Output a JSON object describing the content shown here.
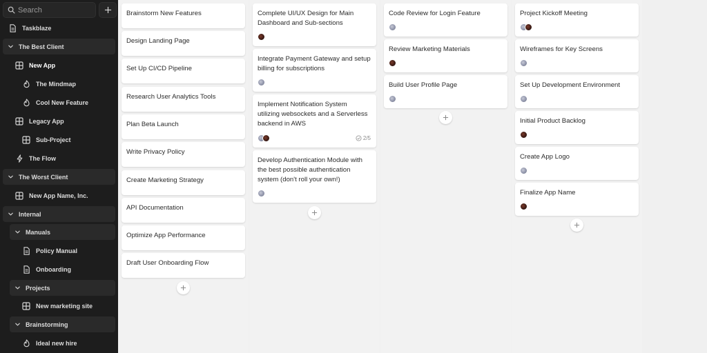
{
  "sidebar": {
    "search_placeholder": "Search",
    "items": [
      {
        "label": "Taskblaze",
        "icon": "doc-icon"
      },
      {
        "label": "The Best Client",
        "icon": "chevron-down-icon"
      },
      {
        "label": "New App",
        "icon": "board-icon"
      },
      {
        "label": "The Mindmap",
        "icon": "flame-icon"
      },
      {
        "label": "Cool New Feature",
        "icon": "flame-icon"
      },
      {
        "label": "Legacy App",
        "icon": "board-icon"
      },
      {
        "label": "Sub-Project",
        "icon": "board-icon"
      },
      {
        "label": "The Flow",
        "icon": "bolt-icon"
      },
      {
        "label": "The Worst Client",
        "icon": "chevron-down-icon"
      },
      {
        "label": "New App Name, Inc.",
        "icon": "board-icon"
      },
      {
        "label": "Internal",
        "icon": "chevron-down-icon"
      },
      {
        "label": "Manuals",
        "icon": "chevron-down-icon"
      },
      {
        "label": "Policy Manual",
        "icon": "doc-icon"
      },
      {
        "label": "Onboarding",
        "icon": "doc-icon"
      },
      {
        "label": "Projects",
        "icon": "chevron-down-icon"
      },
      {
        "label": "New marketing site",
        "icon": "board-icon"
      },
      {
        "label": "Brainstorming",
        "icon": "chevron-down-icon"
      },
      {
        "label": "Ideal new hire",
        "icon": "flame-icon"
      }
    ]
  },
  "columns": [
    {
      "cards": [
        {
          "title": "Brainstorm New Features"
        },
        {
          "title": "Design Landing Page"
        },
        {
          "title": "Set Up CI/CD Pipeline"
        },
        {
          "title": "Research User Analytics Tools"
        },
        {
          "title": "Plan Beta Launch"
        },
        {
          "title": "Write Privacy Policy"
        },
        {
          "title": "Create Marketing Strategy"
        },
        {
          "title": "API Documentation"
        },
        {
          "title": "Optimize App Performance"
        },
        {
          "title": "Draft User Onboarding Flow"
        }
      ]
    },
    {
      "cards": [
        {
          "title": "Complete UI/UX Design for Main Dashboard and Sub-sections",
          "avatars": [
            "a2"
          ]
        },
        {
          "title": "Integrate Payment Gateway and setup billing for subscriptions",
          "avatars": [
            "a1"
          ]
        },
        {
          "title": "Implement Notification System utilizing websockets and a Serverless backend in AWS",
          "avatars": [
            "a1",
            "a2"
          ],
          "progress": "2/5"
        },
        {
          "title": "Develop Authentication Module with the best possible authentication system (don't roll your own!)",
          "avatars": [
            "a1"
          ]
        }
      ]
    },
    {
      "cards": [
        {
          "title": "Code Review for Login Feature",
          "avatars": [
            "a1"
          ]
        },
        {
          "title": "Review Marketing Materials",
          "avatars": [
            "a2"
          ]
        },
        {
          "title": "Build User Profile Page",
          "avatars": [
            "a1"
          ]
        }
      ]
    },
    {
      "cards": [
        {
          "title": "Project Kickoff Meeting",
          "avatars": [
            "a1",
            "a2"
          ]
        },
        {
          "title": "Wireframes for Key Screens",
          "avatars": [
            "a1"
          ]
        },
        {
          "title": "Set Up Development Environment",
          "avatars": [
            "a1"
          ]
        },
        {
          "title": "Initial Product Backlog",
          "avatars": [
            "a2"
          ]
        },
        {
          "title": "Create App Logo",
          "avatars": [
            "a1"
          ]
        },
        {
          "title": "Finalize App Name",
          "avatars": [
            "a2"
          ]
        }
      ]
    }
  ]
}
